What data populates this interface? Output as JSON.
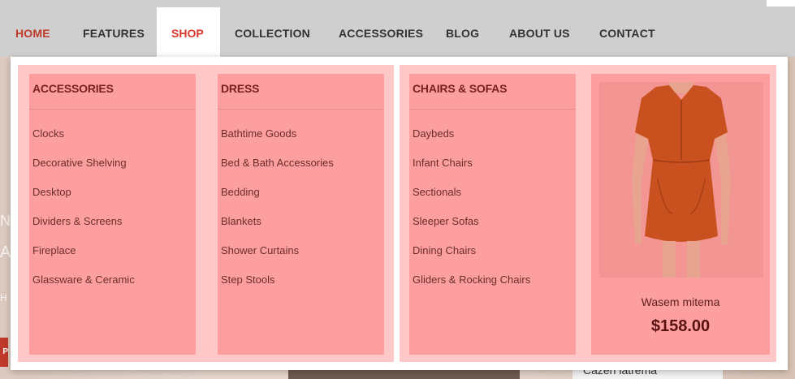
{
  "nav": {
    "items": [
      "HOME",
      "FEATURES",
      "SHOP",
      "COLLECTION",
      "ACCESSORIES",
      "BLOG",
      "ABOUT US",
      "CONTACT"
    ]
  },
  "menu": {
    "columns": [
      {
        "title": "ACCESSORIES",
        "items": [
          "Clocks",
          "Decorative Shelving",
          "Desktop",
          "Dividers & Screens",
          "Fireplace",
          "Glassware & Ceramic"
        ]
      },
      {
        "title": "DRESS",
        "items": [
          "Bathtime Goods",
          "Bed & Bath Accessories",
          "Bedding",
          "Blankets",
          "Shower Curtains",
          "Step Stools"
        ]
      },
      {
        "title": "CHAIRS & SOFAS",
        "items": [
          "Daybeds",
          "Infant Chairs",
          "Sectionals",
          "Sleeper Sofas",
          "Dining Chairs",
          "Gliders & Rocking Chairs"
        ]
      }
    ],
    "product": {
      "name": "Wasem mitema",
      "price": "$158.00"
    }
  },
  "background": {
    "card_text": "Cazen latrema"
  },
  "colors": {
    "accent": "#d9382f",
    "menu_panel": "#fe9f9f",
    "menu_bg": "#fec8c8"
  }
}
